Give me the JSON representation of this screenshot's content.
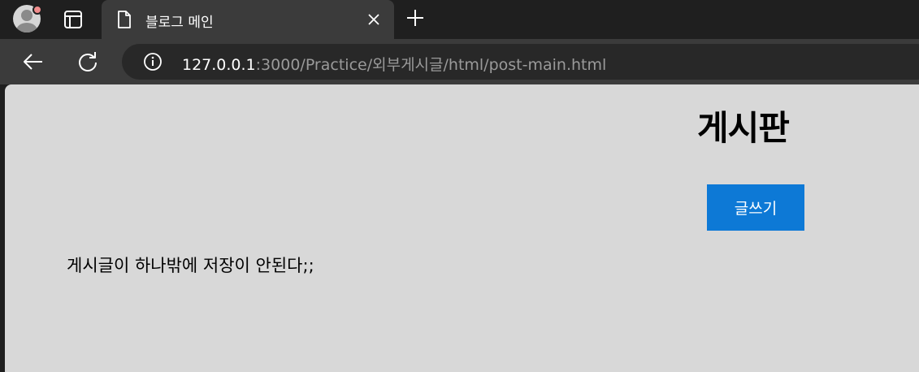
{
  "browser": {
    "tab": {
      "title": "블로그 메인"
    },
    "address_bar": {
      "url_host": "127.0.0.1",
      "url_rest": ":3000/Practice/외부게시글/html/post-main.html"
    },
    "icons": {
      "profile": "profile-avatar-icon",
      "tab_actions": "tab-actions-icon",
      "tab_favicon": "document-icon",
      "tab_close": "close-icon",
      "new_tab": "plus-icon",
      "back": "back-arrow-icon",
      "reload": "reload-icon",
      "site_info": "info-icon"
    },
    "colors": {
      "tab_strip": "#1f1f1f",
      "toolbar": "#3b3b3b",
      "omnibox": "#282828",
      "profile_badge": "#f08c8c"
    }
  },
  "page": {
    "title": "게시판",
    "write_button_label": "글쓰기",
    "post_text": "게시글이 하나밖에 저장이 안된다;;",
    "colors": {
      "background": "#d8d8d8",
      "button": "#0d79d6",
      "button_text": "#ffffff"
    }
  }
}
